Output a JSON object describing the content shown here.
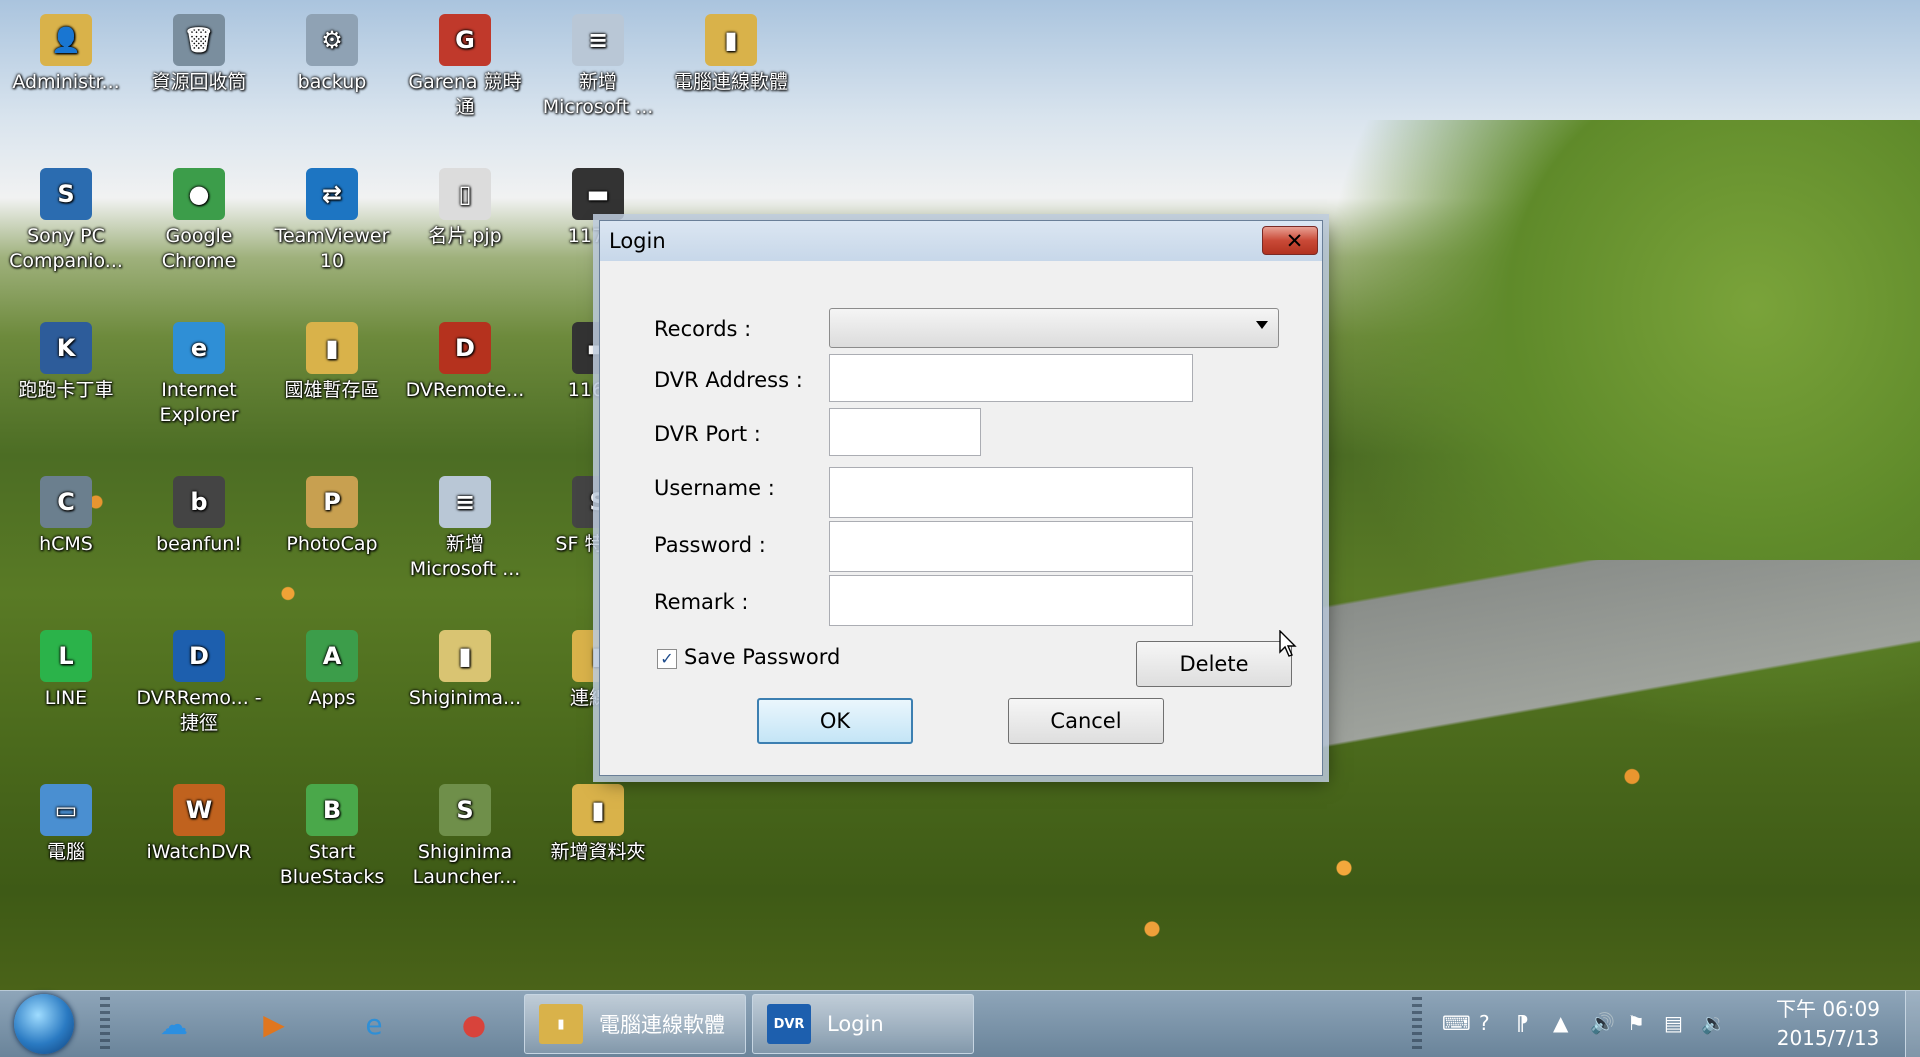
{
  "desktop": {
    "icons": [
      {
        "label": "Administr...",
        "glyph": "👤",
        "color": "#d9b24a",
        "col": 0,
        "row": 0
      },
      {
        "label": "資源回收筒",
        "glyph": "🗑",
        "color": "#7a8e9e",
        "col": 1,
        "row": 0
      },
      {
        "label": "backup",
        "glyph": "⚙",
        "color": "#8fa2b4",
        "col": 2,
        "row": 0
      },
      {
        "label": "Garena 競時通",
        "glyph": "G",
        "color": "#c0392b",
        "col": 3,
        "row": 0
      },
      {
        "label": "新增 Microsoft ...",
        "glyph": "≡",
        "color": "#b9c7d6",
        "col": 4,
        "row": 0
      },
      {
        "label": "電腦連線軟體",
        "glyph": "▮",
        "color": "#d9b24a",
        "col": 5,
        "row": 0
      },
      {
        "label": "Sony PC Companio...",
        "glyph": "S",
        "color": "#2b6cb0",
        "col": 0,
        "row": 1
      },
      {
        "label": "Google Chrome",
        "glyph": "●",
        "color": "#3c9d4a",
        "col": 1,
        "row": 1
      },
      {
        "label": "TeamViewer 10",
        "glyph": "⇄",
        "color": "#1d75c2",
        "col": 2,
        "row": 1
      },
      {
        "label": "名片.pjp",
        "glyph": "▯",
        "color": "#dcdcdc",
        "col": 3,
        "row": 1
      },
      {
        "label": "11713",
        "glyph": "▬",
        "color": "#333333",
        "col": 4,
        "row": 1
      },
      {
        "label": "跑跑卡丁車",
        "glyph": "K",
        "color": "#2d5c9a",
        "col": 0,
        "row": 2
      },
      {
        "label": "Internet Explorer",
        "glyph": "e",
        "color": "#2f8fd6",
        "col": 1,
        "row": 2
      },
      {
        "label": "國雄暫存區",
        "glyph": "▮",
        "color": "#d9b24a",
        "col": 2,
        "row": 2
      },
      {
        "label": "DVRemote...",
        "glyph": "D",
        "color": "#b5321e",
        "col": 3,
        "row": 2
      },
      {
        "label": "11667",
        "glyph": "▬",
        "color": "#333333",
        "col": 4,
        "row": 2
      },
      {
        "label": "hCMS",
        "glyph": "C",
        "color": "#6b7f8e",
        "col": 0,
        "row": 3
      },
      {
        "label": "beanfun!",
        "glyph": "b",
        "color": "#444444",
        "col": 1,
        "row": 3
      },
      {
        "label": "PhotoCap",
        "glyph": "P",
        "color": "#c8a050",
        "col": 2,
        "row": 3
      },
      {
        "label": "新增 Microsoft ...",
        "glyph": "≡",
        "color": "#b9c7d6",
        "col": 3,
        "row": 3
      },
      {
        "label": "SF 特種...",
        "glyph": "S",
        "color": "#444444",
        "col": 4,
        "row": 3
      },
      {
        "label": "LINE",
        "glyph": "L",
        "color": "#2bb34a",
        "col": 0,
        "row": 4
      },
      {
        "label": "DVRRemo... - 捷徑",
        "glyph": "D",
        "color": "#1d5fae",
        "col": 1,
        "row": 4
      },
      {
        "label": "Apps",
        "glyph": "A",
        "color": "#3c9d4a",
        "col": 2,
        "row": 4
      },
      {
        "label": "Shiginima...",
        "glyph": "▮",
        "color": "#d9c472",
        "col": 3,
        "row": 4
      },
      {
        "label": "連線...",
        "glyph": "▮",
        "color": "#d9b24a",
        "col": 4,
        "row": 4
      },
      {
        "label": "電腦",
        "glyph": "▭",
        "color": "#4a8fd1",
        "col": 0,
        "row": 5
      },
      {
        "label": "iWatchDVR",
        "glyph": "W",
        "color": "#c0621e",
        "col": 1,
        "row": 5
      },
      {
        "label": "Start BlueStacks",
        "glyph": "B",
        "color": "#4aa84a",
        "col": 2,
        "row": 5
      },
      {
        "label": "Shiginima Launcher...",
        "glyph": "S",
        "color": "#6f8f4a",
        "col": 3,
        "row": 5
      },
      {
        "label": "新增資料夾",
        "glyph": "▮",
        "color": "#d9b24a",
        "col": 4,
        "row": 5
      }
    ]
  },
  "dialog": {
    "title": "Login",
    "close": "✕",
    "records_label": "Records :",
    "records_value": "",
    "dvr_address_label": "DVR Address :",
    "dvr_address_value": "",
    "dvr_port_label": "DVR Port :",
    "dvr_port_value": "",
    "username_label": "Username :",
    "username_value": "",
    "password_label": "Password :",
    "password_value": "",
    "remark_label": "Remark :",
    "remark_value": "",
    "save_password_label": "Save Password",
    "save_password_checked": true,
    "check_mark": "✓",
    "delete_label": "Delete",
    "ok_label": "OK",
    "cancel_label": "Cancel"
  },
  "taskbar": {
    "pinned": [
      {
        "name": "cloud-icon",
        "glyph": "☁",
        "color": "#2c8fe0"
      },
      {
        "name": "media-player-icon",
        "glyph": "▶",
        "color": "#e0761e"
      },
      {
        "name": "internet-explorer-icon",
        "glyph": "e",
        "color": "#2f8fd6"
      },
      {
        "name": "chrome-icon",
        "glyph": "●",
        "color": "#d8433b"
      }
    ],
    "tasks": [
      {
        "label": "電腦連線軟體",
        "glyph": "▮",
        "color": "#d9b24a"
      },
      {
        "label": "Login",
        "glyph": "DVR",
        "color": "#1d5fae"
      }
    ],
    "tray": [
      "⌨",
      "?",
      "⁋",
      "▲",
      "🔊",
      "⚑",
      "▤",
      "🔉"
    ],
    "time": "下午 06:09",
    "date": "2015/7/13"
  }
}
